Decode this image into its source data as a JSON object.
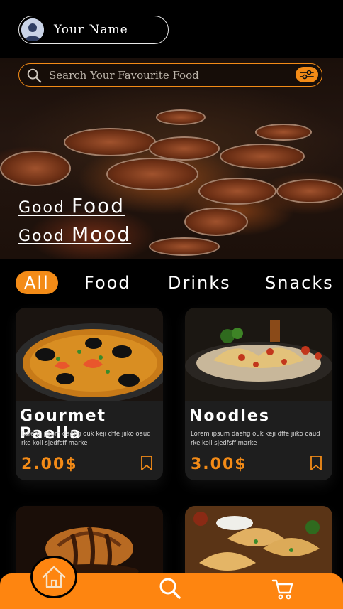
{
  "profile": {
    "name": "Your Name"
  },
  "search": {
    "placeholder": "Search Your Favourite Food"
  },
  "hero": {
    "line1_a": "Good ",
    "line1_b": "Food",
    "line2_a": "Good ",
    "line2_b": "Mood"
  },
  "tabs": [
    {
      "label": "All",
      "active": true
    },
    {
      "label": "Food",
      "active": false
    },
    {
      "label": "Drinks",
      "active": false
    },
    {
      "label": "Snacks",
      "active": false
    }
  ],
  "products": [
    {
      "name": "Gourmet Paella",
      "description": "Lorem ipsum daefig ouk keji dffe jiiko oaud rke koli sjedfsff marke",
      "price": "2.00$"
    },
    {
      "name": "Noodles",
      "description": "Lorem ipsum daefig ouk keji dffe jiiko oaud rke koli sjedfsff marke",
      "price": "3.00$"
    }
  ],
  "colors": {
    "accent": "#f38b17",
    "nav": "#fe8510",
    "card": "#1e1e1e",
    "background": "#000000"
  },
  "icons": [
    "avatar-icon",
    "search-icon",
    "filter-icon",
    "bookmark-icon",
    "home-icon",
    "cart-icon"
  ]
}
